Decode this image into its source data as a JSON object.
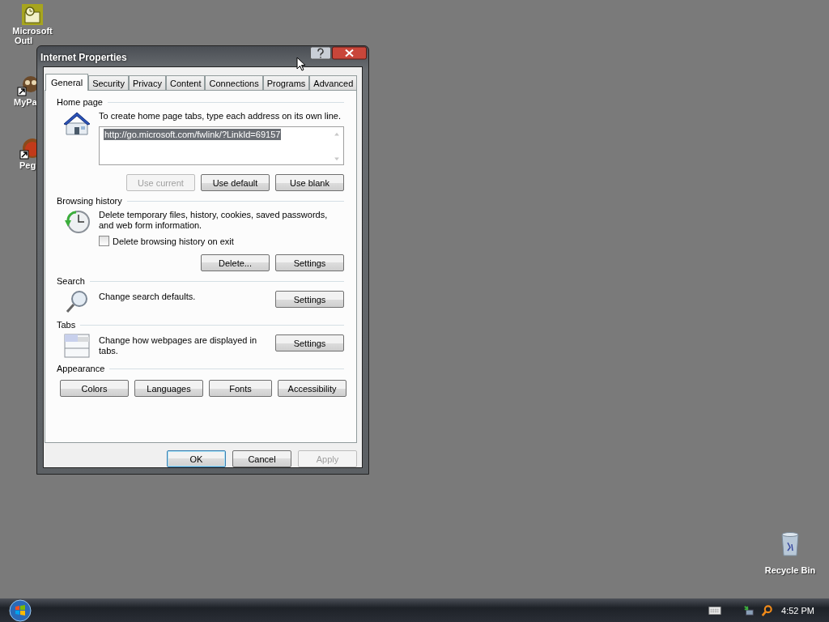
{
  "desktop_icons": [
    {
      "kind": "outlook",
      "label_lines": [
        "Microsoft",
        "Outl"
      ]
    },
    {
      "kind": "mypage",
      "label_lines": [
        "MyPa"
      ]
    },
    {
      "kind": "peg",
      "label_lines": [
        "Peg"
      ]
    },
    {
      "kind": "recycle",
      "label_lines": [
        "Recycle Bin"
      ]
    }
  ],
  "dialog": {
    "title": "Internet Properties",
    "tabs": [
      {
        "label": "General",
        "selected": true
      },
      {
        "label": "Security",
        "selected": false
      },
      {
        "label": "Privacy",
        "selected": false
      },
      {
        "label": "Content",
        "selected": false
      },
      {
        "label": "Connections",
        "selected": false
      },
      {
        "label": "Programs",
        "selected": false
      },
      {
        "label": "Advanced",
        "selected": false
      }
    ],
    "sections": [
      {
        "kind": "home",
        "heading": "Home page",
        "text": "To create home page tabs, type each address on its own line.",
        "field": {
          "value": "http://go.microsoft.com/fwlink/?LinkId=69157",
          "selected": true
        },
        "buttons": [
          {
            "label": "Use current",
            "disabled": true
          },
          {
            "label": "Use default",
            "disabled": false
          },
          {
            "label": "Use blank",
            "disabled": false
          }
        ]
      },
      {
        "kind": "history",
        "heading": "Browsing history",
        "text": "Delete temporary files, history, cookies, saved passwords, and web form information.",
        "checkbox": {
          "label": "Delete browsing history on exit",
          "checked": false
        },
        "buttons": [
          {
            "label": "Delete...",
            "disabled": false
          },
          {
            "label": "Settings",
            "disabled": false
          }
        ]
      },
      {
        "kind": "search",
        "heading": "Search",
        "text": "Change search defaults.",
        "buttons": [
          {
            "label": "Settings",
            "disabled": false
          }
        ]
      },
      {
        "kind": "tabs",
        "heading": "Tabs",
        "text": "Change how webpages are displayed in tabs.",
        "buttons": [
          {
            "label": "Settings",
            "disabled": false
          }
        ]
      },
      {
        "kind": "appearance",
        "heading": "Appearance",
        "buttons": [
          {
            "label": "Colors",
            "disabled": false
          },
          {
            "label": "Languages",
            "disabled": false
          },
          {
            "label": "Fonts",
            "disabled": false
          },
          {
            "label": "Accessibility",
            "disabled": false
          }
        ]
      }
    ],
    "footer_buttons": [
      {
        "label": "OK",
        "disabled": false,
        "default": true
      },
      {
        "label": "Cancel",
        "disabled": false,
        "default": false
      },
      {
        "label": "Apply",
        "disabled": true,
        "default": false
      }
    ]
  },
  "taskbar": {
    "clock": "4:52 PM"
  }
}
